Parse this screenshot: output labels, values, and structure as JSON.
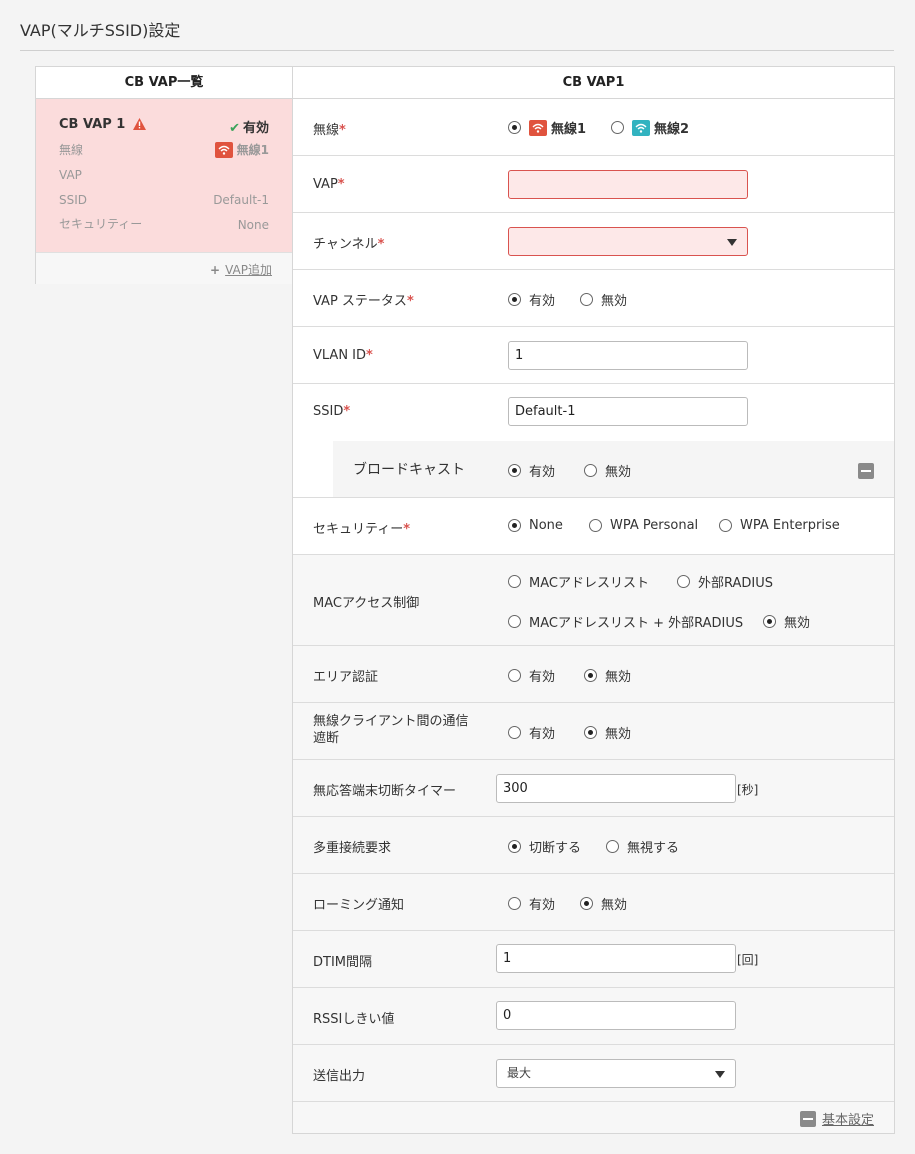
{
  "page": {
    "title": "VAP(マルチSSID)設定"
  },
  "left": {
    "header": "CB VAP一覧",
    "card": {
      "name": "CB VAP 1",
      "status": "有効",
      "fields": [
        {
          "label": "無線",
          "value": "無線1"
        },
        {
          "label": "VAP",
          "value": ""
        },
        {
          "label": "SSID",
          "value": "Default-1"
        },
        {
          "label": "セキュリティー",
          "value": "None"
        }
      ]
    },
    "add_label": "VAP追加"
  },
  "right": {
    "header": "CB VAP1",
    "required_mark": "*",
    "wireless": {
      "label": "無線",
      "options": [
        "無線1",
        "無線2"
      ],
      "selected": 0
    },
    "vap": {
      "label": "VAP",
      "value": ""
    },
    "channel": {
      "label": "チャンネル",
      "value": ""
    },
    "vap_status": {
      "label": "VAP ステータス",
      "options": [
        "有効",
        "無効"
      ],
      "selected": 0
    },
    "vlan_id": {
      "label": "VLAN ID",
      "value": "1"
    },
    "ssid": {
      "label": "SSID",
      "value": "Default-1"
    },
    "broadcast": {
      "label": "ブロードキャスト",
      "options": [
        "有効",
        "無効"
      ],
      "selected": 0
    },
    "security": {
      "label": "セキュリティー",
      "options": [
        "None",
        "WPA Personal",
        "WPA Enterprise"
      ],
      "selected": 0
    },
    "mac_access": {
      "label": "MACアクセス制御",
      "options": [
        "MACアドレスリスト",
        "外部RADIUS",
        "MACアドレスリスト + 外部RADIUS",
        "無効"
      ],
      "selected": 3
    },
    "area_auth": {
      "label": "エリア認証",
      "options": [
        "有効",
        "無効"
      ],
      "selected": 1
    },
    "client_isolation": {
      "label": "無線クライアント間の通信遮断",
      "label_line1": "無線クライアント間の通信",
      "label_line2": "遮断",
      "options": [
        "有効",
        "無効"
      ],
      "selected": 1
    },
    "idle_timer": {
      "label": "無応答端末切断タイマー",
      "value": "300",
      "unit": "[秒]"
    },
    "multi_conn": {
      "label": "多重接続要求",
      "options": [
        "切断する",
        "無視する"
      ],
      "selected": 0
    },
    "roaming": {
      "label": "ローミング通知",
      "options": [
        "有効",
        "無効"
      ],
      "selected": 1
    },
    "dtim": {
      "label": "DTIM間隔",
      "value": "1",
      "unit": "[回]"
    },
    "rssi": {
      "label": "RSSIしきい値",
      "value": "0"
    },
    "tx_power": {
      "label": "送信出力",
      "value": "最大"
    },
    "footer_link": "基本設定"
  },
  "colors": {
    "error_bg": "#fde8e8",
    "error_border": "#d9534f",
    "card_bg": "#fbdcdc",
    "radio1": "#e0533e",
    "radio2": "#32b3c0",
    "ok": "#3aa35a"
  },
  "icons": [
    "warning-icon",
    "check-icon",
    "wifi-icon",
    "plus-icon",
    "minus-icon",
    "dropdown-arrow-icon"
  ]
}
